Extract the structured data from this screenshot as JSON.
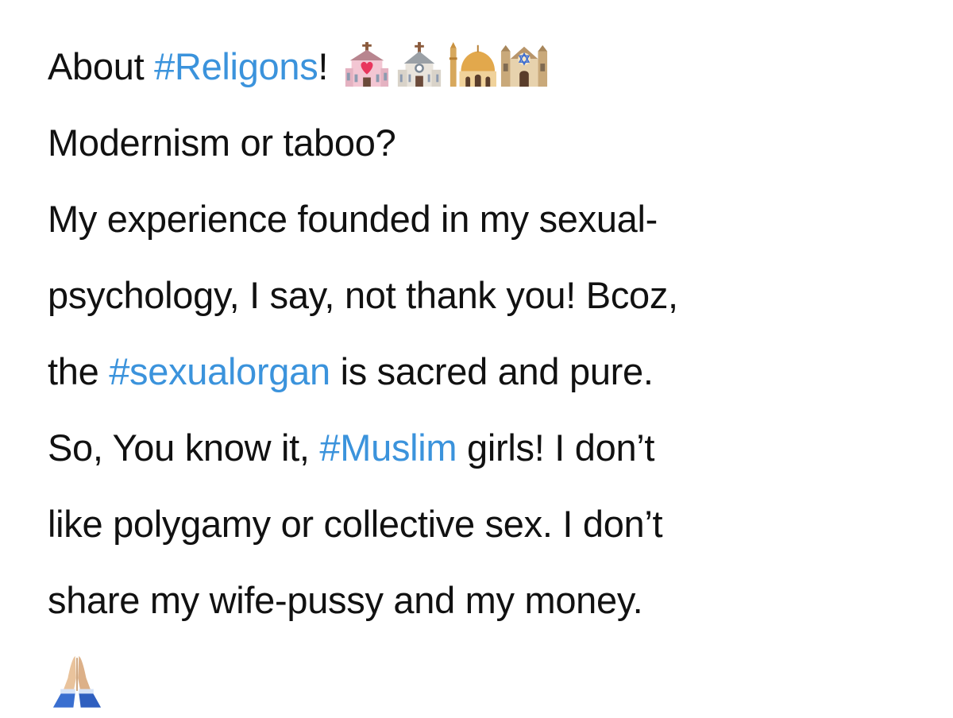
{
  "tweet": {
    "line1": {
      "t1": "About ",
      "h1": "#Religons",
      "t2": "!"
    },
    "line2": "Modernism or taboo?",
    "line3": "My experience founded in my sexual-",
    "line4": "psychology, I say, not thank you! Bcoz,",
    "line5": {
      "t1": "the ",
      "h1": "#sexualorgan",
      "t2": " is sacred and pure."
    },
    "line6": {
      "t1": "So, You know it, ",
      "h1": "#Muslim",
      "t2": " girls! I don’t"
    },
    "line7": "like polygamy or collective sex. I don’t",
    "line8": "share my wife-pussy and my money."
  },
  "emojis": [
    "wedding-icon",
    "church-icon",
    "mosque-icon",
    "synagogue-icon"
  ],
  "closing_emoji": "folded-hands-icon",
  "colors": {
    "text": "#111111",
    "hashtag": "#3b93dc",
    "background": "#ffffff"
  }
}
